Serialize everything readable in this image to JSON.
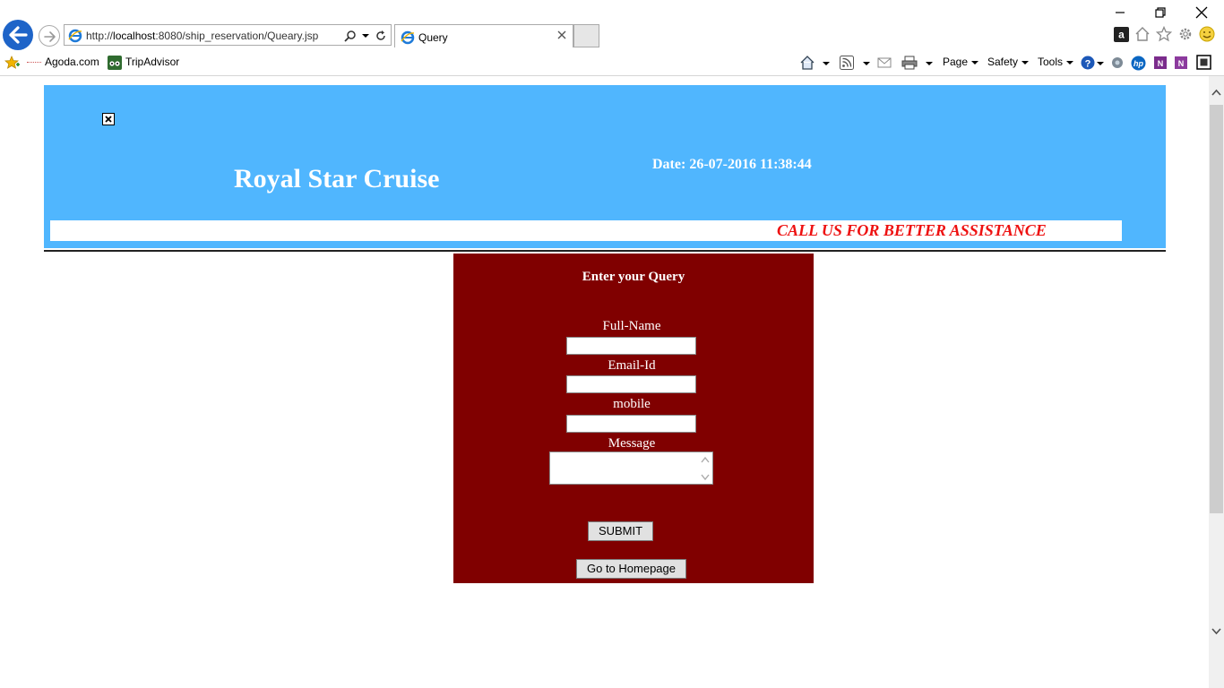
{
  "browser": {
    "address_url_prefix": "http://",
    "address_url_host": "localhost",
    "address_url_rest": ":8080/ship_reservation/Queary.jsp",
    "tab_title": "Query",
    "favorites": [
      "Agoda.com",
      "TripAdvisor"
    ],
    "commands": {
      "page": "Page",
      "safety": "Safety",
      "tools": "Tools"
    }
  },
  "header": {
    "site_title": "Royal Star Cruise",
    "date_line": "Date: 26-07-2016 11:38:44",
    "marquee": "CALL US FOR BETTER ASSISTANCE"
  },
  "form": {
    "heading": "Enter your Query",
    "fullname_label": "Full-Name",
    "fullname_value": "",
    "email_label": "Email-Id",
    "email_value": "",
    "mobile_label": "mobile",
    "mobile_value": "",
    "message_label": "Message",
    "message_value": "",
    "submit_label": "SUBMIT",
    "home_label": "Go to Homepage"
  },
  "colors": {
    "header_bg": "#50b6fe",
    "form_bg": "#800000",
    "marquee_text": "#ee1111",
    "browser_back": "#1e64c8"
  },
  "icons": [
    "back-arrow-icon",
    "forward-arrow-icon",
    "ie-logo-icon",
    "search-icon",
    "refresh-icon",
    "close-tab-icon",
    "minimize-icon",
    "restore-icon",
    "close-window-icon",
    "amazon-icon",
    "home-icon",
    "star-icon",
    "gear-icon",
    "smiley-icon",
    "add-favorites-icon",
    "tripadvisor-icon",
    "feeds-icon",
    "mail-icon",
    "print-icon",
    "help-icon",
    "broken-image-icon",
    "spinner-icon"
  ]
}
